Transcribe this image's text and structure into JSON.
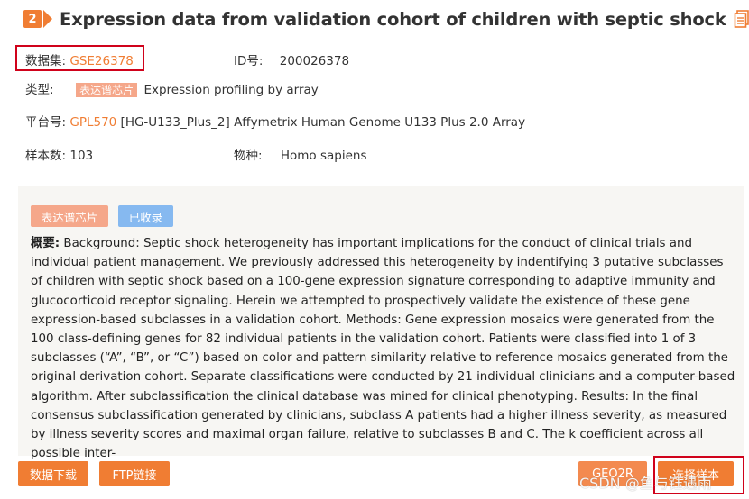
{
  "header": {
    "index": "2",
    "title": "Expression data from validation cohort of children with septic shock"
  },
  "meta": {
    "dataset_label": "数据集:",
    "dataset_value": "GSE26378",
    "id_label": "ID号:",
    "id_value": "200026378",
    "type_label": "类型:",
    "type_tag": "表达谱芯片",
    "type_value": "Expression profiling by array",
    "platform_label": "平台号:",
    "platform_value": "GPL570",
    "platform_desc": "[HG-U133_Plus_2] Affymetrix Human Genome U133 Plus 2.0 Array",
    "samples_label": "样本数:",
    "samples_value": "103",
    "species_label": "物种:",
    "species_value": "Homo sapiens"
  },
  "panel": {
    "tag_type": "表达谱芯片",
    "tag_status": "已收录",
    "summary_label": "概要:",
    "summary_text": "Background: Septic shock heterogeneity has important implications for the conduct of clinical trials and individual patient management. We previously addressed this heterogeneity by indentifying 3 putative subclasses of children with septic shock based on a 100-gene expression signature corresponding to adaptive immunity and glucocorticoid receptor signaling. Herein we attempted to prospectively validate the existence of these gene expression-based subclasses in a validation cohort. Methods: Gene expression mosaics were generated from the 100 class-defining genes for 82 individual patients in the validation cohort. Patients were classified into 1 of 3 subclasses (“A”, “B”, or “C”) based on color and pattern similarity relative to reference mosaics generated from the original derivation cohort. Separate classifications were conducted by 21 individual clinicians and a computer-based algorithm. After subclassification the clinical database was mined for clinical phenotyping. Results: In the final consensus subclassification generated by clinicians, subclass A patients had a higher illness severity, as measured by illness severity scores and maximal organ failure, relative to subclasses B and C. The k coefficient across all possible inter-"
  },
  "buttons": {
    "download": "数据下载",
    "ftp": "FTP链接",
    "geo2r": "GEO2R",
    "select_samples": "选择样本"
  },
  "watermark": "CSDN @鱼与钰遇雨",
  "colors": {
    "accent": "#f07d33",
    "highlight_border": "#d0021b",
    "tag_light_orange": "#f5a78a",
    "tag_blue": "#86b9f0"
  }
}
